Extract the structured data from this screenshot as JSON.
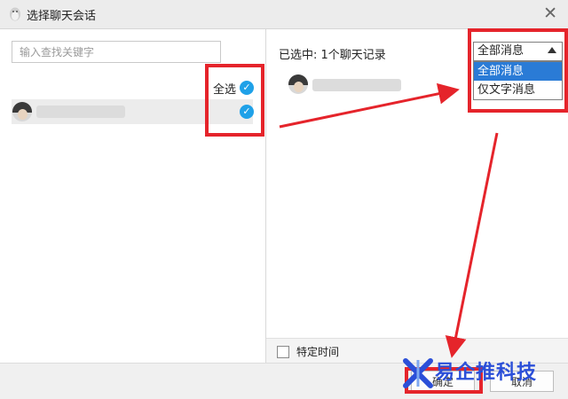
{
  "window": {
    "title": "选择聊天会话",
    "close_glyph": "✕"
  },
  "left": {
    "search_placeholder": "输入查找关键字",
    "select_all_label": "全选",
    "check_glyph": "✓",
    "contacts": [
      {
        "name": "",
        "checked": true
      }
    ]
  },
  "right": {
    "selected_count": "已选中: 1个聊天记录",
    "filter": {
      "current": "全部消息",
      "options": [
        "全部消息",
        "仅文字消息"
      ],
      "highlighted_index": 0
    },
    "specific_time_label": "特定时间",
    "specific_time_checked": false
  },
  "footer": {
    "confirm_label": "确定",
    "cancel_label": "取消"
  },
  "watermark": {
    "text": "易企推科技"
  },
  "colors": {
    "annotation_red": "#e5242b",
    "check_blue": "#1fa1e8",
    "highlight_blue": "#2a7bd6",
    "watermark_blue": "#2b4fd8"
  }
}
